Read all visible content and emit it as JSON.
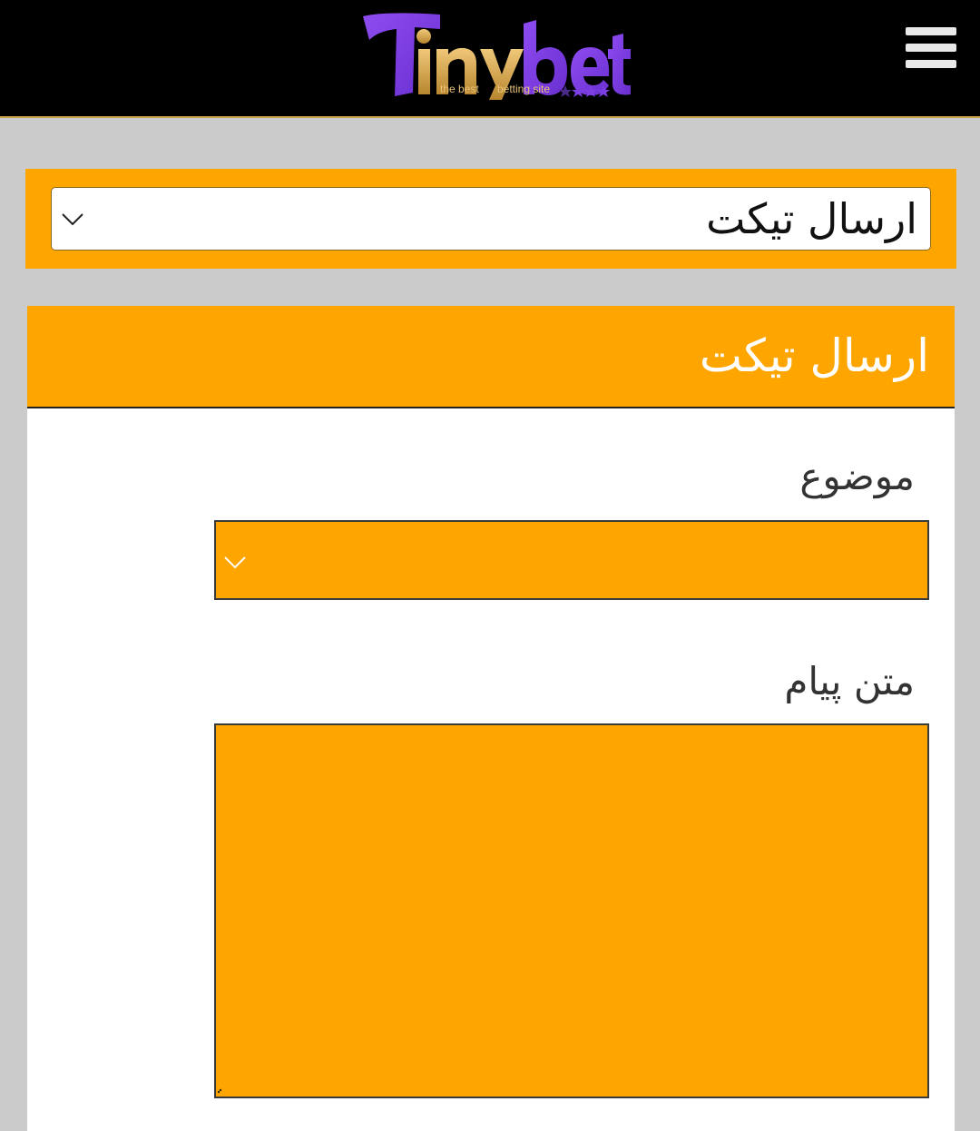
{
  "header": {
    "logo": {
      "brand": "Tinybet",
      "tagline_left": "the best",
      "tagline_right": "betting site"
    },
    "menu_icon": "hamburger-menu-icon"
  },
  "nav": {
    "selected": "ارسال تیکت",
    "chevron_icon": "chevron-down-icon"
  },
  "form": {
    "title": "ارسال تیکت",
    "subject_label": "موضوع",
    "subject_value": "",
    "message_label": "متن پیام",
    "message_value": ""
  },
  "colors": {
    "accent": "#ffa500",
    "header_bg": "#000000",
    "page_bg": "#cbcbcb",
    "logo_purple": "#7b3fe4",
    "logo_gold": "#d4a94a"
  }
}
